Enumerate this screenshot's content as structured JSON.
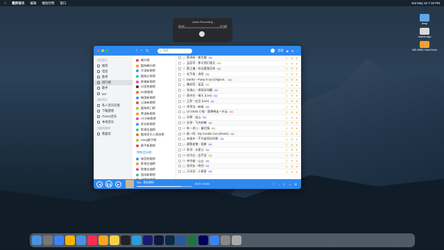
{
  "menubar": {
    "apple": "",
    "app": "酷狗音乐",
    "items": [
      "编辑",
      "播放控制",
      "窗口"
    ],
    "clock": "Sat May 15 7:16 PM"
  },
  "recorder": {
    "title": "Audio Recording",
    "t_start": "00:00",
    "t_end": "47 MB"
  },
  "desktop": {
    "icons": [
      "temp",
      "macos-app",
      "WD MINE Hard Drive"
    ]
  },
  "app": {
    "search_placeholder": "搜索",
    "user": "登录",
    "sidebar": [
      {
        "section": "在线音乐",
        "items": [
          "推荐",
          "电台",
          "歌单",
          "排行榜",
          "歌手",
          "MV"
        ]
      },
      {
        "section": "我的音乐",
        "items": [
          "私人音乐云盘",
          "下载管理",
          "iTunes音乐",
          "本地音乐"
        ]
      },
      {
        "section": "创建的歌单",
        "items": [
          "我喜欢"
        ]
      }
    ],
    "active_item": "排行榜",
    "channels": [
      {
        "name": "飙升榜",
        "color": "#e44"
      },
      {
        "name": "酷狗飙升榜",
        "color": "#f90"
      },
      {
        "name": "华语新歌榜",
        "color": "#39f"
      },
      {
        "name": "酷狗分享榜",
        "color": "#3c8"
      },
      {
        "name": "欧美新歌榜",
        "color": "#e4a"
      },
      {
        "name": "抖音热歌榜",
        "color": "#333"
      },
      {
        "name": "DJ热歌榜",
        "color": "#f60"
      },
      {
        "name": "韩国新歌榜",
        "color": "#39f"
      },
      {
        "name": "日本新歌榜",
        "color": "#e44"
      },
      {
        "name": "酷狗热门榜",
        "color": "#9c3"
      },
      {
        "name": "粤语新歌榜",
        "color": "#f90"
      },
      {
        "name": "ACG新歌榜",
        "color": "#e4a"
      },
      {
        "name": "综艺新歌榜",
        "color": "#39f"
      },
      {
        "name": "影视金曲榜",
        "color": "#3c8"
      },
      {
        "name": "酷狗音乐人原创榜",
        "color": "#f60"
      },
      {
        "name": "Song歌手榜",
        "color": "#9c3"
      },
      {
        "name": "歌手新歌榜",
        "color": "#e44"
      }
    ],
    "channels_section": "特色音乐榜",
    "channels2": [
      {
        "name": "电音热歌榜",
        "color": "#39f"
      },
      {
        "name": "影视金曲榜",
        "color": "#f90"
      },
      {
        "name": "欧美金曲榜",
        "color": "#e4a"
      },
      {
        "name": "国风新歌榜",
        "color": "#3c8"
      },
      {
        "name": "说唱先锋榜",
        "color": "#e44"
      },
      {
        "name": "酷狗分享榜",
        "color": "#39f"
      }
    ],
    "songs": [
      {
        "n": "1",
        "t": "蔡卓妍 - 夜生趣",
        "tag": "HQ",
        "c": ""
      },
      {
        "n": "2",
        "t": "孟庭苇 - 那天我们遇见",
        "tag": "HQ",
        "c": "g"
      },
      {
        "n": "3",
        "t": "薛之谦 - 你还要我怎样",
        "tag": "SQ",
        "c": ""
      },
      {
        "n": "4",
        "t": "毛不易 - 消愁",
        "tag": "HQ",
        "c": ""
      },
      {
        "n": "5",
        "t": "Danko - Pump It Up (Original...",
        "tag": "HQ",
        "c": ""
      },
      {
        "n": "6",
        "t": "魏如萱 - 某某",
        "tag": "SQ",
        "c": "g"
      },
      {
        "n": "7",
        "t": "金海心 - 把耳朵叫醒",
        "tag": "HQ",
        "c": ""
      },
      {
        "n": "8",
        "t": "周杰伦 - 晴天 (Live)",
        "tag": "HQ",
        "c": ""
      },
      {
        "n": "9",
        "t": "王菲 - 红豆 (Live)",
        "tag": "SQ",
        "c": ""
      },
      {
        "n": "10",
        "t": "李荣浩 - 麻雀",
        "tag": "HQ",
        "c": ""
      },
      {
        "n": "11",
        "t": "Lil Ghost 小鬼 - 我想带走一片云",
        "tag": "HQ",
        "c": "r"
      },
      {
        "n": "12",
        "t": "花粥 - 出山",
        "tag": "SQ",
        "c": ""
      },
      {
        "n": "13",
        "t": "任然 - 飞鸟和蝉",
        "tag": "HQ",
        "c": ""
      },
      {
        "n": "14",
        "t": "陈一发儿 - 童话镇",
        "tag": "HQ",
        "c": "g"
      },
      {
        "n": "15",
        "t": "陈一鸣 - My Cookie Can (Remix)",
        "tag": "SQ",
        "c": ""
      },
      {
        "n": "16",
        "t": "林俊杰 - 不为谁而作的歌",
        "tag": "HQ",
        "c": ""
      },
      {
        "n": "17",
        "t": "隔壁老樊 - 我曾",
        "tag": "HQ",
        "c": ""
      },
      {
        "n": "18",
        "t": "郭顶 - 水星记",
        "tag": "SQ",
        "c": ""
      },
      {
        "n": "19",
        "t": "刘大壮 - 会不会",
        "tag": "HQ",
        "c": "g"
      },
      {
        "n": "20",
        "t": "李宗盛 - 山丘",
        "tag": "HQ",
        "c": ""
      },
      {
        "n": "21",
        "t": "张学友 - 吻别",
        "tag": "SQ",
        "c": ""
      },
      {
        "n": "22",
        "t": "汪苏泷 - 小星星",
        "tag": "HQ",
        "c": ""
      }
    ],
    "player": {
      "song": "Sky - 我在想你",
      "time": "00:01 / 04:52",
      "progress": 0.8
    }
  },
  "dock": [
    "Finder",
    "Launchpad",
    "Safari",
    "Chrome",
    "Mail",
    "Music",
    "Photos",
    "Notes",
    "Terminal",
    "Preview",
    "Pr",
    "Ps",
    "Lr",
    "Word",
    "Excel",
    "Au",
    "Keynote",
    "Settings",
    "Trash"
  ]
}
